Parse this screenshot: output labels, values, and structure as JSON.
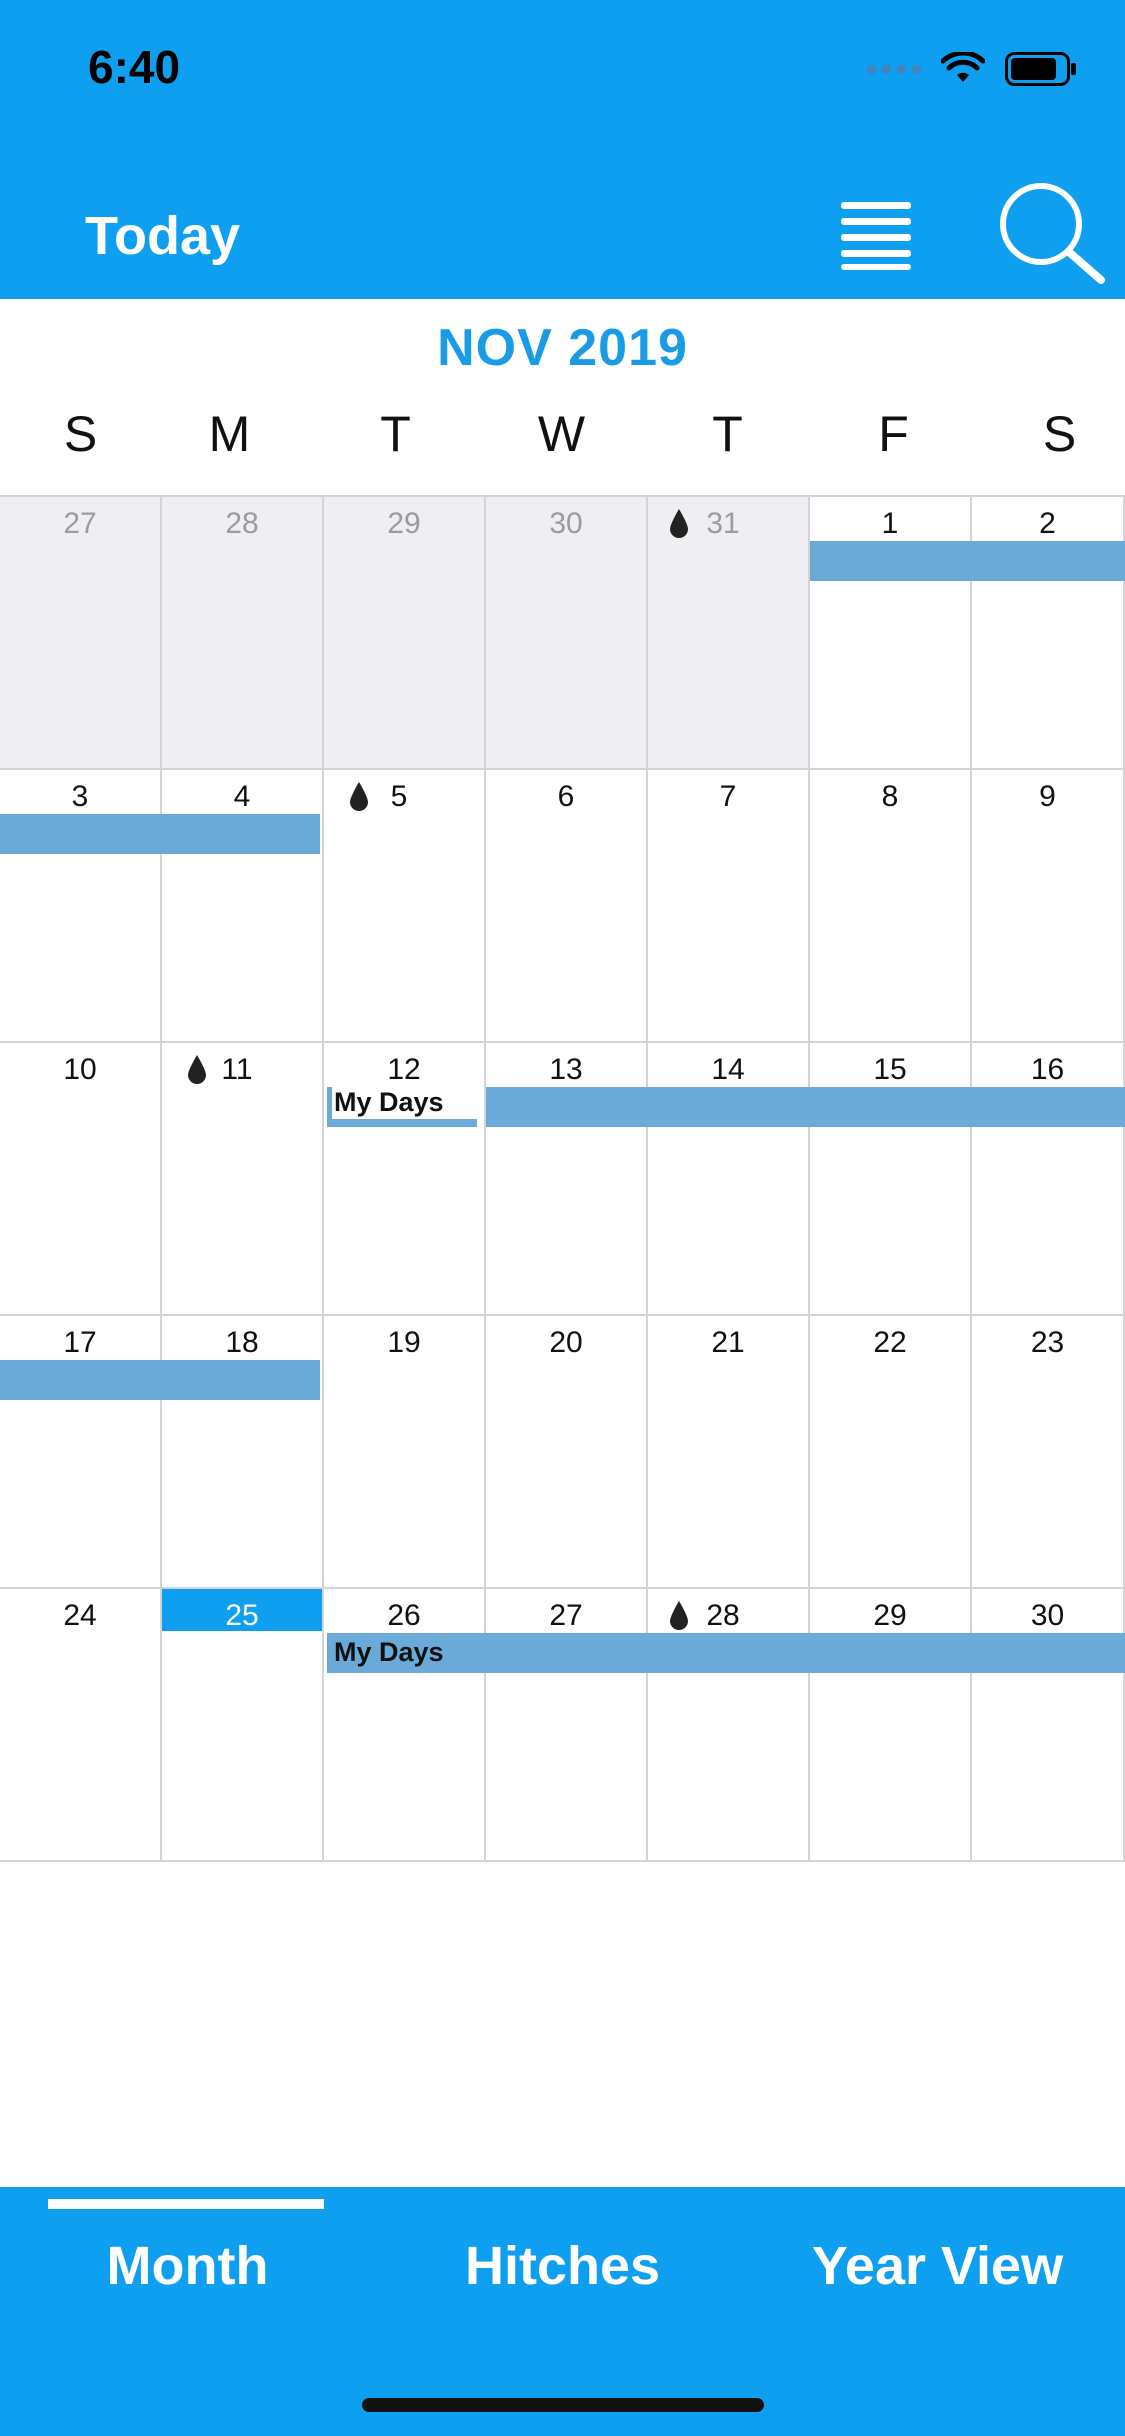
{
  "status_bar": {
    "time": "6:40"
  },
  "header": {
    "today_label": "Today"
  },
  "calendar": {
    "month_title": "NOV 2019",
    "weekdays": [
      "S",
      "M",
      "T",
      "W",
      "T",
      "F",
      "S"
    ],
    "weeks": [
      [
        "27",
        "28",
        "29",
        "30",
        "31",
        "1",
        "2"
      ],
      [
        "3",
        "4",
        "5",
        "6",
        "7",
        "8",
        "9"
      ],
      [
        "10",
        "11",
        "12",
        "13",
        "14",
        "15",
        "16"
      ],
      [
        "17",
        "18",
        "19",
        "20",
        "21",
        "22",
        "23"
      ],
      [
        "24",
        "25",
        "26",
        "27",
        "28",
        "29",
        "30"
      ]
    ],
    "events": [
      {
        "label": "My Days"
      },
      {
        "label": "My Days"
      }
    ]
  },
  "tabs": [
    "Month",
    "Hitches",
    "Year View"
  ],
  "colors": {
    "accent": "#0e9ff0",
    "event_bar": "#6aaad8",
    "other_month_bg": "#efeff3"
  }
}
